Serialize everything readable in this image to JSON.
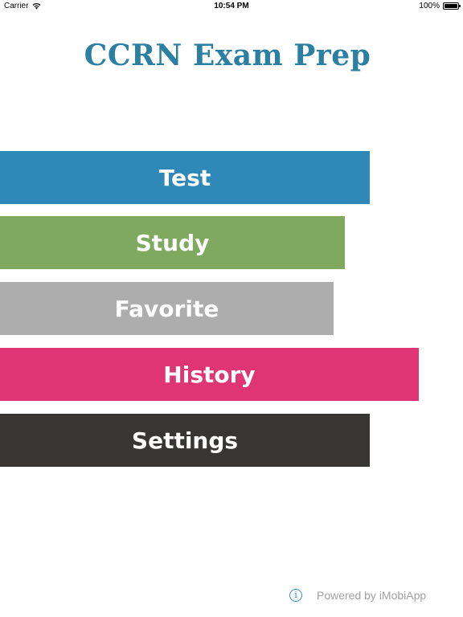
{
  "status_bar": {
    "carrier": "Carrier",
    "time": "10:54 PM",
    "battery": "100%"
  },
  "app": {
    "title": "CCRN Exam Prep"
  },
  "menu": {
    "items": [
      {
        "label": "Test",
        "color": "#2e89b8"
      },
      {
        "label": "Study",
        "color": "#7fa95e"
      },
      {
        "label": "Favorite",
        "color": "#adadad"
      },
      {
        "label": "History",
        "color": "#e03575"
      },
      {
        "label": "Settings",
        "color": "#383634"
      }
    ]
  },
  "footer": {
    "info_icon": "i",
    "powered_by": "Powered by iMobiApp"
  },
  "colors": {
    "title": "#2a7fa3",
    "info_accent": "#2c8fd9",
    "footer_text": "#a0a0a0"
  }
}
